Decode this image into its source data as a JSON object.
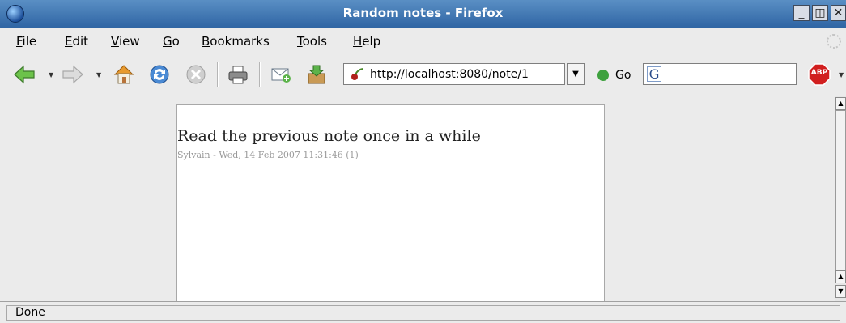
{
  "window": {
    "title": "Random notes - Firefox"
  },
  "menu": [
    {
      "label": "File",
      "mnemonic": "F",
      "rest": "ile"
    },
    {
      "label": "Edit",
      "mnemonic": "E",
      "rest": "dit"
    },
    {
      "label": "View",
      "mnemonic": "V",
      "rest": "iew"
    },
    {
      "label": "Go",
      "mnemonic": "G",
      "rest": "o"
    },
    {
      "label": "Bookmarks",
      "mnemonic": "B",
      "rest": "ookmarks"
    },
    {
      "label": "Tools",
      "mnemonic": "T",
      "rest": "ools"
    },
    {
      "label": "Help",
      "mnemonic": "H",
      "rest": "elp"
    }
  ],
  "toolbar": {
    "url": "http://localhost:8080/note/1",
    "go_label": "Go",
    "search_engine_letter": "G",
    "adblock_label": "ABP"
  },
  "page": {
    "note_title": "Read the previous note once in a while",
    "note_meta": "Sylvain - Wed, 14 Feb 2007 11:31:46 (1)"
  },
  "status": {
    "text": "Done"
  },
  "colors": {
    "titlebar": "#3c72b0",
    "go_green": "#3ea13e",
    "abp_red": "#d11f1f"
  }
}
